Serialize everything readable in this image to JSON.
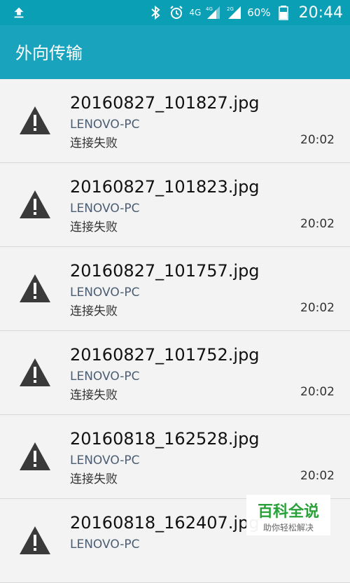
{
  "status_bar": {
    "left_icon": "upload-arrow-icon",
    "icons": [
      "bluetooth-icon",
      "alarm-icon",
      "signal-4g-icon",
      "signal-2g-icon",
      "battery-icon"
    ],
    "net_label_1": "4G",
    "net_label_2": "4G",
    "net_label_3": "2G",
    "battery": "60%",
    "time": "20:44"
  },
  "app_bar": {
    "title": "外向传输"
  },
  "colors": {
    "status_bar": "#0a9fb5",
    "app_bar": "#1aa3bd",
    "device_text": "#4b5d73",
    "watermark_green": "#2aa13a"
  },
  "transfers": [
    {
      "file": "20160827_101827.jpg",
      "device": "LENOVO-PC",
      "status": "连接失败",
      "time": "20:02",
      "icon": "warning-icon"
    },
    {
      "file": "20160827_101823.jpg",
      "device": "LENOVO-PC",
      "status": "连接失败",
      "time": "20:02",
      "icon": "warning-icon"
    },
    {
      "file": "20160827_101757.jpg",
      "device": "LENOVO-PC",
      "status": "连接失败",
      "time": "20:02",
      "icon": "warning-icon"
    },
    {
      "file": "20160827_101752.jpg",
      "device": "LENOVO-PC",
      "status": "连接失败",
      "time": "20:02",
      "icon": "warning-icon"
    },
    {
      "file": "20160818_162528.jpg",
      "device": "LENOVO-PC",
      "status": "连接失败",
      "time": "20:02",
      "icon": "warning-icon"
    },
    {
      "file": "20160818_162407.jpg",
      "device": "LENOVO-PC",
      "status": "",
      "time": "",
      "icon": "warning-icon"
    }
  ],
  "watermark": {
    "main": "百科全说",
    "sub": "助你轻松解决"
  }
}
